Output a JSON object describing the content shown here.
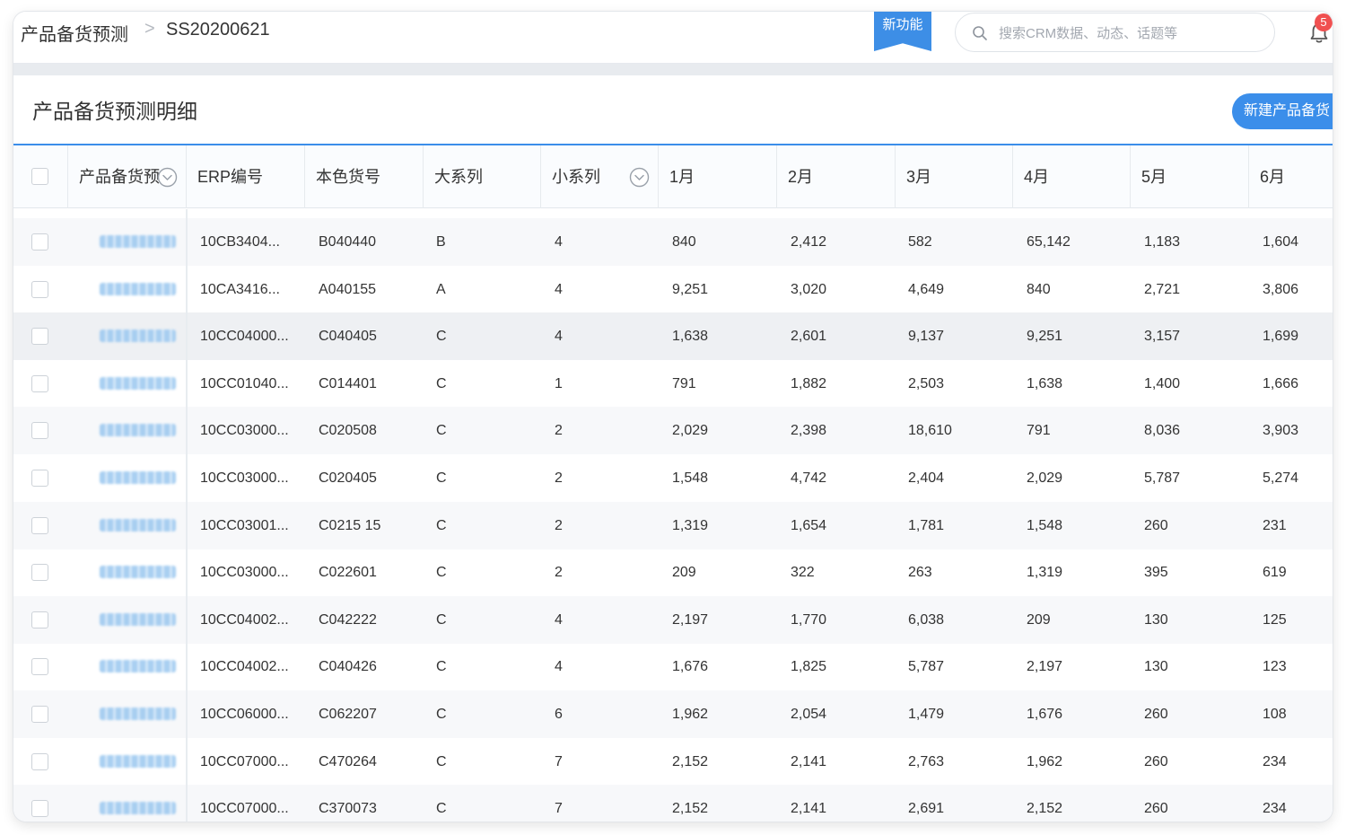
{
  "breadcrumb": {
    "parent": "产品备货预测",
    "separator": ">",
    "current": "SS20200621"
  },
  "topbar": {
    "new_feature": "新功能",
    "search_placeholder": "搜索CRM数据、动态、话题等",
    "notification_count": "5"
  },
  "panel": {
    "title": "产品备货预测明细",
    "new_button": "新建产品备货"
  },
  "table": {
    "headers": [
      "产品备货预",
      "ERP编号",
      "本色货号",
      "大系列",
      "小系列",
      "1月",
      "2月",
      "3月",
      "4月",
      "5月",
      "6月"
    ],
    "rows": [
      {
        "erp": "10CB3404...",
        "color_no": "B040440",
        "big": "B",
        "small": "4",
        "m1": "840",
        "m2": "2,412",
        "m3": "582",
        "m4": "65,142",
        "m5": "1,183",
        "m6": "1,604"
      },
      {
        "erp": "10CA3416...",
        "color_no": "A040155",
        "big": "A",
        "small": "4",
        "m1": "9,251",
        "m2": "3,020",
        "m3": "4,649",
        "m4": "840",
        "m5": "2,721",
        "m6": "3,806"
      },
      {
        "erp": "10CC04000...",
        "color_no": "C040405",
        "big": "C",
        "small": "4",
        "m1": "1,638",
        "m2": "2,601",
        "m3": "9,137",
        "m4": "9,251",
        "m5": "3,157",
        "m6": "1,699"
      },
      {
        "erp": "10CC01040...",
        "color_no": "C014401",
        "big": "C",
        "small": "1",
        "m1": "791",
        "m2": "1,882",
        "m3": "2,503",
        "m4": "1,638",
        "m5": "1,400",
        "m6": "1,666"
      },
      {
        "erp": "10CC03000...",
        "color_no": "C020508",
        "big": "C",
        "small": "2",
        "m1": "2,029",
        "m2": "2,398",
        "m3": "18,610",
        "m4": "791",
        "m5": "8,036",
        "m6": "3,903"
      },
      {
        "erp": "10CC03000...",
        "color_no": "C020405",
        "big": "C",
        "small": "2",
        "m1": "1,548",
        "m2": "4,742",
        "m3": "2,404",
        "m4": "2,029",
        "m5": "5,787",
        "m6": "5,274"
      },
      {
        "erp": "10CC03001...",
        "color_no": "C0215 15",
        "big": "C",
        "small": "2",
        "m1": "1,319",
        "m2": "1,654",
        "m3": "1,781",
        "m4": "1,548",
        "m5": "260",
        "m6": "231"
      },
      {
        "erp": "10CC03000...",
        "color_no": "C022601",
        "big": "C",
        "small": "2",
        "m1": "209",
        "m2": "322",
        "m3": "263",
        "m4": "1,319",
        "m5": "395",
        "m6": "619"
      },
      {
        "erp": "10CC04002...",
        "color_no": "C042222",
        "big": "C",
        "small": "4",
        "m1": "2,197",
        "m2": "1,770",
        "m3": "6,038",
        "m4": "209",
        "m5": "130",
        "m6": "125"
      },
      {
        "erp": "10CC04002...",
        "color_no": "C040426",
        "big": "C",
        "small": "4",
        "m1": "1,676",
        "m2": "1,825",
        "m3": "5,787",
        "m4": "2,197",
        "m5": "130",
        "m6": "123"
      },
      {
        "erp": "10CC06000...",
        "color_no": "C062207",
        "big": "C",
        "small": "6",
        "m1": "1,962",
        "m2": "2,054",
        "m3": "1,479",
        "m4": "1,676",
        "m5": "260",
        "m6": "108"
      },
      {
        "erp": "10CC07000...",
        "color_no": "C470264",
        "big": "C",
        "small": "7",
        "m1": "2,152",
        "m2": "2,141",
        "m3": "2,763",
        "m4": "1,962",
        "m5": "260",
        "m6": "234"
      },
      {
        "erp": "10CC07000...",
        "color_no": "C370073",
        "big": "C",
        "small": "7",
        "m1": "2,152",
        "m2": "2,141",
        "m3": "2,691",
        "m4": "2,152",
        "m5": "260",
        "m6": "234"
      }
    ]
  },
  "colors": {
    "accent": "#3b8eea",
    "badge": "#f05050",
    "header_bg": "#fafcfe"
  }
}
